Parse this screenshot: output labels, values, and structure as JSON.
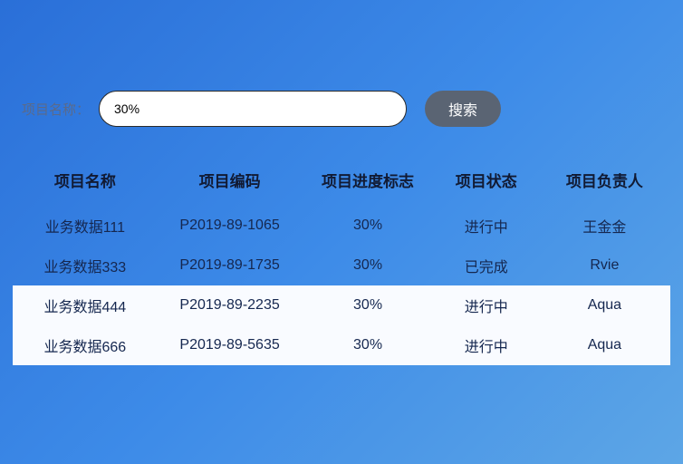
{
  "search": {
    "label": "项目名称：",
    "value": "30%",
    "button": "搜索"
  },
  "table": {
    "headers": {
      "name": "项目名称",
      "code": "项目编码",
      "progress": "项目进度标志",
      "status": "项目状态",
      "owner": "项目负责人"
    },
    "rows": [
      {
        "name": "业务数据111",
        "code": "P2019-89-1065",
        "progress": "30%",
        "status": "进行中",
        "owner": "王金金",
        "selected": false
      },
      {
        "name": "业务数据333",
        "code": "P2019-89-1735",
        "progress": "30%",
        "status": "已完成",
        "owner": "Rvie",
        "selected": false
      },
      {
        "name": "业务数据444",
        "code": "P2019-89-2235",
        "progress": "30%",
        "status": "进行中",
        "owner": "Aqua",
        "selected": true
      },
      {
        "name": "业务数据666",
        "code": "P2019-89-5635",
        "progress": "30%",
        "status": "进行中",
        "owner": "Aqua",
        "selected": true
      }
    ]
  }
}
